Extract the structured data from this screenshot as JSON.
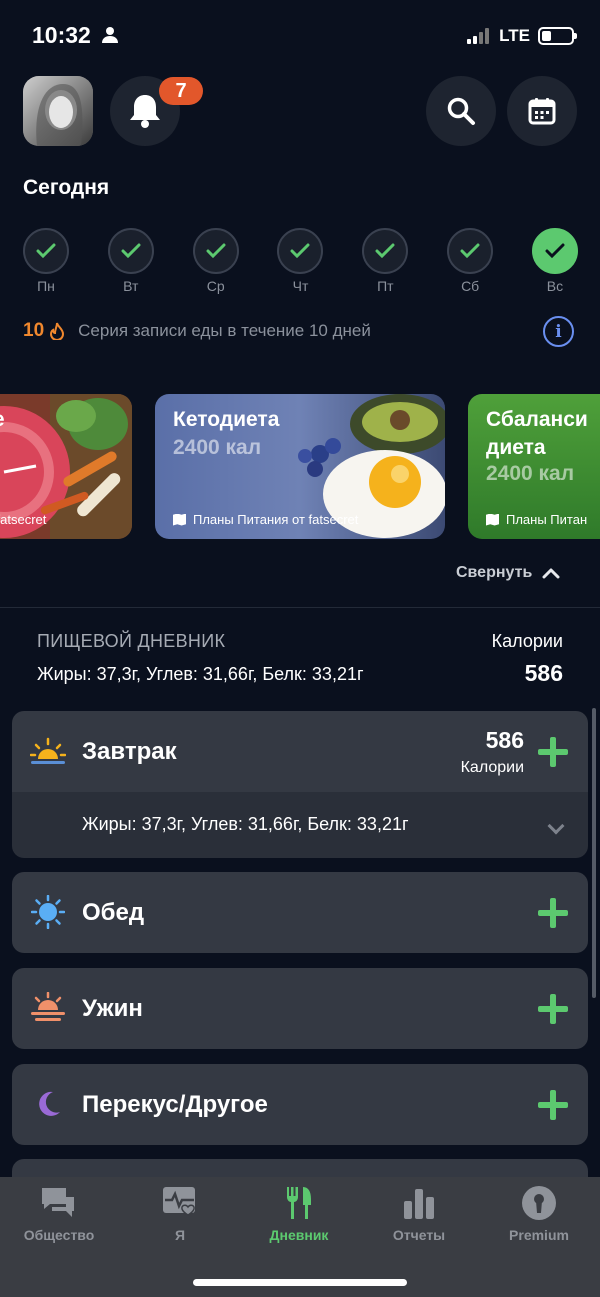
{
  "status": {
    "time": "10:32",
    "network": "LTE"
  },
  "notifications": {
    "count": "7"
  },
  "today_label": "Сегодня",
  "week": [
    {
      "label": "Пн",
      "done": true,
      "active": false
    },
    {
      "label": "Вт",
      "done": true,
      "active": false
    },
    {
      "label": "Ср",
      "done": true,
      "active": false
    },
    {
      "label": "Чт",
      "done": true,
      "active": false
    },
    {
      "label": "Пт",
      "done": true,
      "active": false
    },
    {
      "label": "Сб",
      "done": true,
      "active": false
    },
    {
      "label": "Вс",
      "done": true,
      "active": true
    }
  ],
  "streak": {
    "count": "10",
    "text": "Серия записи еды в течение 10 дней"
  },
  "cards": [
    {
      "title": "ое",
      "kcal": "",
      "footer": "от fatsecret"
    },
    {
      "title": "Кетодиета",
      "kcal": "2400 кал",
      "footer": "Планы Питания от fatsecret"
    },
    {
      "title": "Сбаланси диета",
      "title_line1": "Сбаланси",
      "title_line2": "диета",
      "kcal": "2400 кал",
      "footer": "Планы Питан"
    }
  ],
  "collapse_label": "Свернуть",
  "diary": {
    "title": "ПИЩЕВОЙ ДНЕВНИК",
    "macros": "Жиры: 37,3г, Углев: 31,66г, Белк: 33,21г",
    "calories_label": "Калории",
    "calories_value": "586"
  },
  "meals": {
    "breakfast": {
      "name": "Завтрак",
      "calories": "586",
      "calories_label": "Калории",
      "macros": "Жиры: 37,3г, Углев: 31,66г, Белк: 33,21г"
    },
    "lunch": {
      "name": "Обед"
    },
    "dinner": {
      "name": "Ужин"
    },
    "snack": {
      "name": "Перекус/Другое"
    }
  },
  "tabs": [
    {
      "label": "Общество",
      "icon": "chat-icon",
      "active": false
    },
    {
      "label": "Я",
      "icon": "heart-pulse-icon",
      "active": false
    },
    {
      "label": "Дневник",
      "icon": "fork-knife-icon",
      "active": true
    },
    {
      "label": "Отчеты",
      "icon": "bar-chart-icon",
      "active": false
    },
    {
      "label": "Premium",
      "icon": "keyhole-icon",
      "active": false
    }
  ],
  "colors": {
    "accent": "#5cc96f",
    "badge": "#e2572b",
    "streak": "#f0882e",
    "info": "#6a8ff0"
  }
}
